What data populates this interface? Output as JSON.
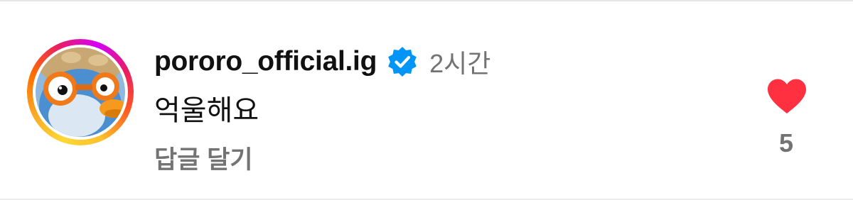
{
  "comment": {
    "username": "pororo_official.ig",
    "verified": true,
    "timestamp": "2시간",
    "text": "억울해요",
    "reply_label": "답글 달기",
    "like_count": "5",
    "liked": true
  },
  "icons": {
    "verified": "verified-badge-icon",
    "like": "heart-filled-icon"
  },
  "colors": {
    "verified_blue": "#0095f6",
    "heart_red": "#ff3040",
    "secondary_text": "#737373",
    "primary_text": "#111111"
  }
}
